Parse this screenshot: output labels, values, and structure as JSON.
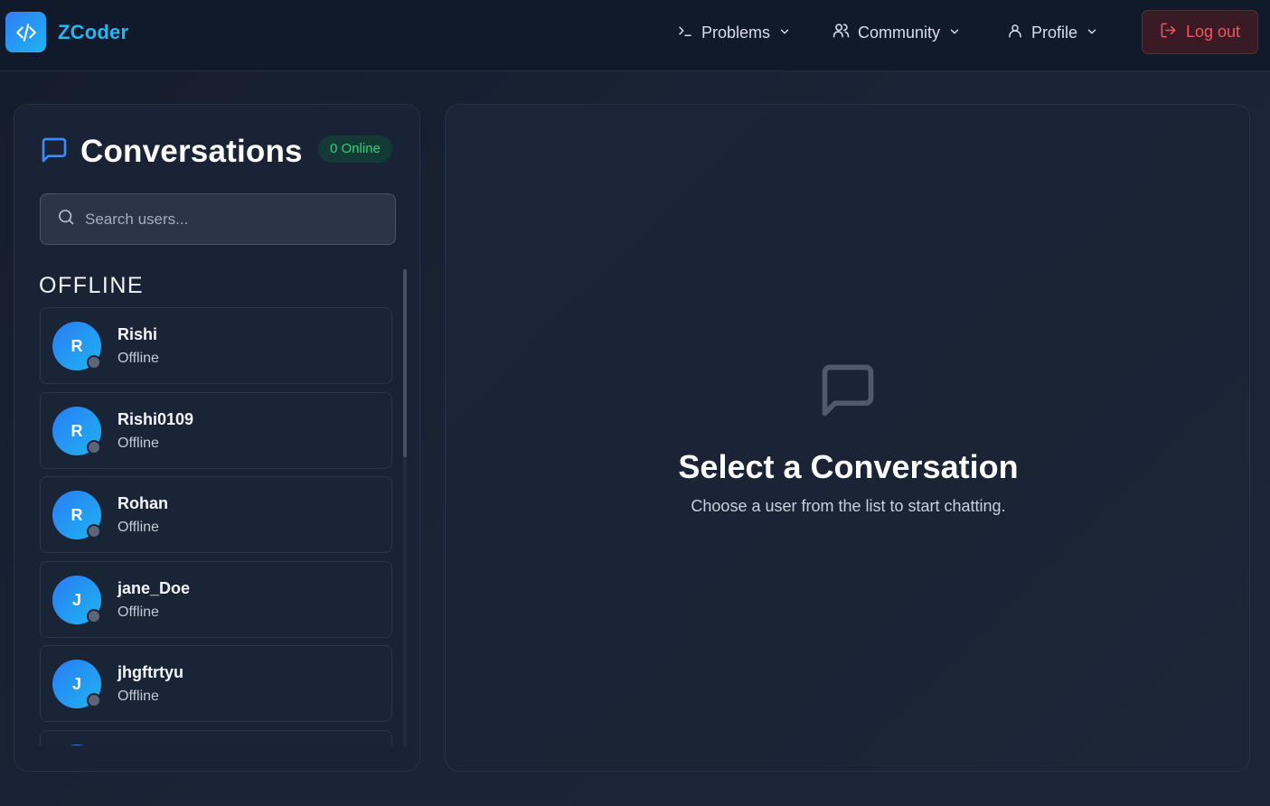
{
  "header": {
    "brand": "ZCoder",
    "nav": [
      {
        "label": "Problems",
        "icon": "terminal-icon"
      },
      {
        "label": "Community",
        "icon": "users-icon"
      },
      {
        "label": "Profile",
        "icon": "user-icon"
      }
    ],
    "logout_label": "Log out"
  },
  "sidebar": {
    "title": "Conversations",
    "online_badge": "0 Online",
    "search_placeholder": "Search users...",
    "section_label": "OFFLINE",
    "users": [
      {
        "initial": "R",
        "name": "Rishi",
        "status": "Offline"
      },
      {
        "initial": "R",
        "name": "Rishi0109",
        "status": "Offline"
      },
      {
        "initial": "R",
        "name": "Rohan",
        "status": "Offline"
      },
      {
        "initial": "J",
        "name": "jane_Doe",
        "status": "Offline"
      },
      {
        "initial": "J",
        "name": "jhgftrtyu",
        "status": "Offline"
      }
    ]
  },
  "main": {
    "empty_title": "Select a Conversation",
    "empty_subtitle": "Choose a user from the list to start chatting."
  },
  "colors": {
    "accent": "#22b8f0",
    "online": "#2fd17a",
    "logout": "#f2555e"
  }
}
